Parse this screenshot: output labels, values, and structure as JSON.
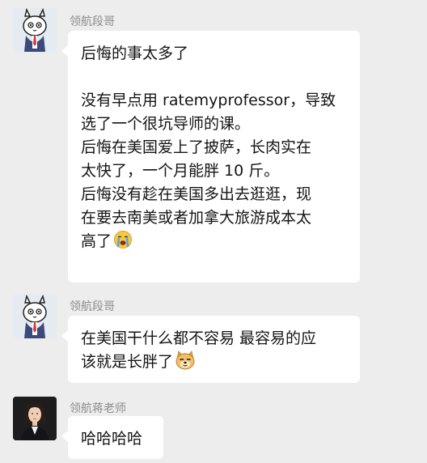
{
  "messages": [
    {
      "sender": "领航段哥",
      "avatar": "cartoon-cat-avatar",
      "lines": [
        "后悔的事太多了",
        "",
        "没有早点用 ratemyprofessor，导致",
        "选了一个很坑导师的课。",
        "后悔在美国爱上了披萨，长肉实在",
        "太快了，一个月能胖 10 斤。",
        "后悔没有趁在美国多出去逛逛，现",
        "在要去南美或者加拿大旅游成本太",
        "高了"
      ],
      "trailing_emoji": "crying-face-emoji"
    },
    {
      "sender": "领航段哥",
      "avatar": "cartoon-cat-avatar",
      "lines": [
        "在美国干什么都不容易 最容易的应",
        "该就是长胖了"
      ],
      "trailing_emoji": "doge-emoji"
    },
    {
      "sender": "领航蒋老师",
      "avatar": "woman-photo-avatar",
      "lines": [
        "哈哈哈哈"
      ]
    }
  ],
  "colors": {
    "background": "#ededed",
    "bubble": "#ffffff",
    "sender_name": "#8c8c8c"
  }
}
